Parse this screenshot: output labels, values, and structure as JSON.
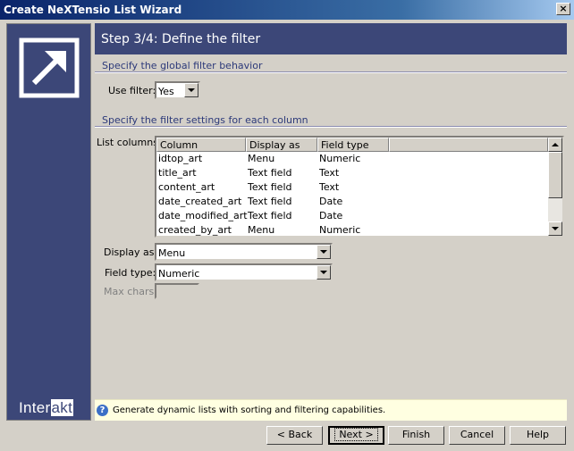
{
  "window": {
    "title": "Create NeXTensio List Wizard",
    "close_symbol": "×"
  },
  "sidebar": {
    "brand_part1": "Inter",
    "brand_part2": "akt"
  },
  "step": {
    "title": "Step 3/4: Define the filter"
  },
  "global_section": {
    "heading": "Specify the global filter behavior",
    "use_filter_label": "Use filter:",
    "use_filter_value": "Yes"
  },
  "columns_section": {
    "heading": "Specify the filter settings for each column",
    "list_label": "List columns:",
    "headers": [
      "Column",
      "Display as",
      "Field type"
    ],
    "rows": [
      [
        "idtop_art",
        "Menu",
        "Numeric"
      ],
      [
        "title_art",
        "Text field",
        "Text"
      ],
      [
        "content_art",
        "Text field",
        "Text"
      ],
      [
        "date_created_art",
        "Text field",
        "Date"
      ],
      [
        "date_modified_art",
        "Text field",
        "Date"
      ],
      [
        "created_by_art",
        "Menu",
        "Numeric"
      ]
    ],
    "display_as_label": "Display as:",
    "display_as_value": "Menu",
    "field_type_label": "Field type:",
    "field_type_value": "Numeric",
    "max_chars_label": "Max chars:",
    "max_chars_value": ""
  },
  "info": {
    "icon": "question-icon",
    "icon_glyph": "?",
    "text": "Generate dynamic lists with sorting and filtering capabilities."
  },
  "buttons": {
    "back": "< Back",
    "next": "Next >",
    "finish": "Finish",
    "cancel": "Cancel",
    "help": "Help"
  },
  "colors": {
    "panel": "#3c4778",
    "title_gradient_start": "#0a246a",
    "info_background": "#ffffe1",
    "section_text": "#2d3a7a"
  }
}
